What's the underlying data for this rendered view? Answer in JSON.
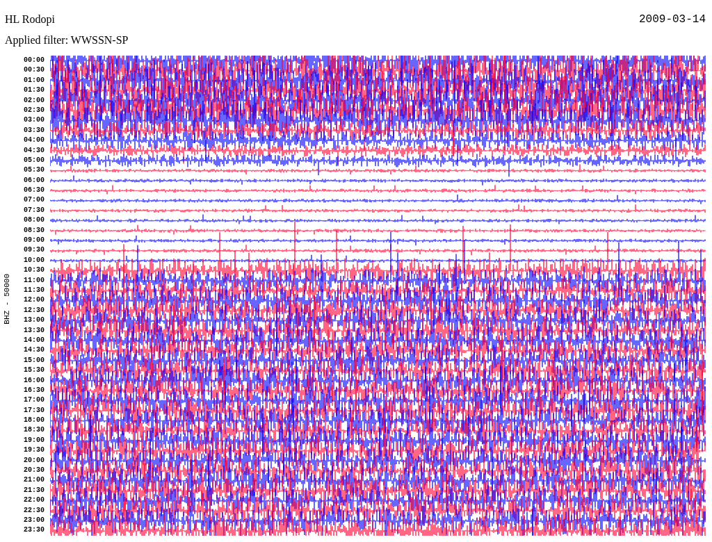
{
  "station": "HL Rodopi",
  "date": "2009-03-14",
  "filter_label": "Applied filter: WWSSN-SP",
  "channel_label": "BHZ - 50000",
  "time_labels": [
    "00:00",
    "00:30",
    "01:00",
    "01:30",
    "02:00",
    "02:30",
    "03:00",
    "03:30",
    "04:00",
    "04:30",
    "05:00",
    "05:30",
    "06:00",
    "06:30",
    "07:00",
    "07:30",
    "08:00",
    "08:30",
    "09:00",
    "09:30",
    "10:00",
    "10:30",
    "11:00",
    "11:30",
    "12:00",
    "12:30",
    "13:00",
    "13:30",
    "14:00",
    "14:30",
    "15:00",
    "15:30",
    "16:00",
    "16:30",
    "17:00",
    "17:30",
    "18:00",
    "18:30",
    "19:00",
    "19:30",
    "20:00",
    "20:30",
    "21:00",
    "21:30",
    "22:00",
    "22:30",
    "23:00",
    "23:30"
  ]
}
